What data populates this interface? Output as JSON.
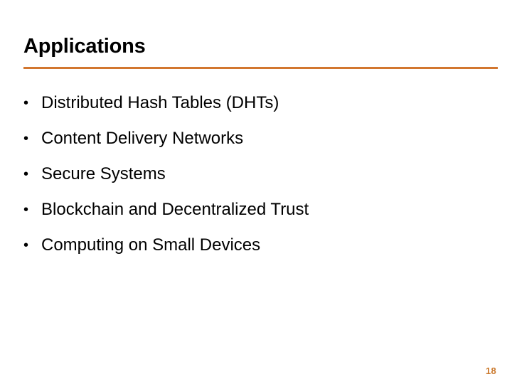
{
  "slide": {
    "title": "Applications",
    "accent_color": "#D2762F",
    "background_color": "#FFFFFF",
    "text_color": "#000000",
    "page_number": "18",
    "page_number_color": "#CB7A2E",
    "bullet_glyph": "•",
    "bullets": [
      {
        "label": "Distributed Hash Tables (DHTs)"
      },
      {
        "label": "Content Delivery Networks"
      },
      {
        "label": "Secure Systems"
      },
      {
        "label": "Blockchain and Decentralized Trust"
      },
      {
        "label": "Computing on Small Devices"
      }
    ]
  }
}
